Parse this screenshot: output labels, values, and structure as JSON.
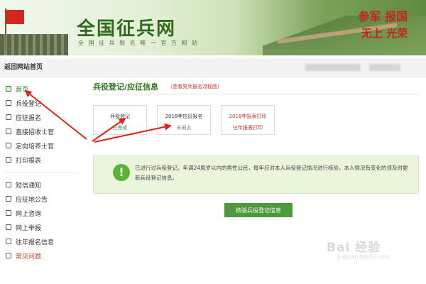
{
  "header": {
    "site_title": "全国征兵网",
    "site_subtitle": "全 国 征 兵 报 名 唯 一 官 方 网 站",
    "slogan_line1": "参军 报国",
    "slogan_line2": "无上 光荣"
  },
  "sidebar": {
    "header": "返回网站首页",
    "items": [
      {
        "label": "首页"
      },
      {
        "label": "兵役登记"
      },
      {
        "label": "应征报名"
      },
      {
        "label": "直接招收士官"
      },
      {
        "label": "定向培养士官"
      },
      {
        "label": "打印报表"
      },
      {
        "label": "短信通知"
      },
      {
        "label": "应征地公告"
      },
      {
        "label": "网上咨询"
      },
      {
        "label": "网上举报"
      },
      {
        "label": "往年报名信息"
      },
      {
        "label": "常见问题"
      }
    ]
  },
  "main": {
    "title": "兵役登记/应征信息",
    "link": "（查看男兵报名流程图）",
    "steps": [
      {
        "title": "兵役登记",
        "status": "已完成"
      },
      {
        "title": "2018年应征报名",
        "status": "未报名"
      },
      {
        "title": "2018年报表打印",
        "status": "往年报表打印"
      }
    ],
    "notice": "已进行过兵役登记。年满24周岁以内的男性公民，每年应对本人兵役登记情况进行核验，本人情况有变化的须及时更新兵役登记信息。",
    "button": "核验兵役登记信息"
  },
  "watermark": {
    "text": "Bai 经验",
    "sub": "jingyan.baidu.com"
  },
  "colors": {
    "brand_green": "#2e7d1e",
    "notice_bg": "#eaf5dc",
    "button_green": "#4e9a3a",
    "arrow_red": "#e0231a"
  }
}
